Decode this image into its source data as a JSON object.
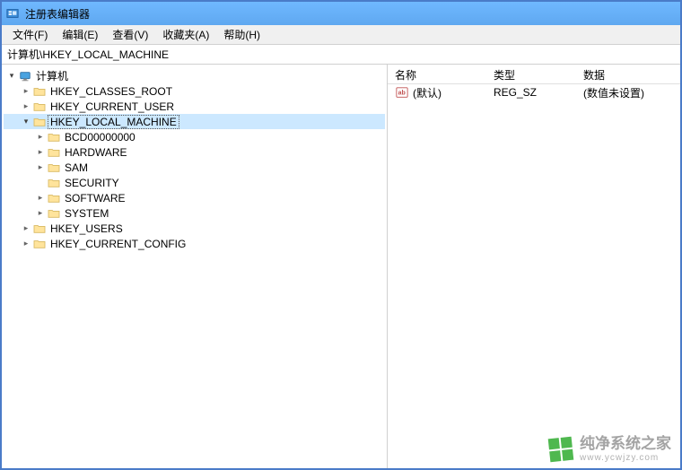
{
  "window": {
    "title": "注册表编辑器"
  },
  "menu": {
    "file": "文件(F)",
    "edit": "编辑(E)",
    "view": "查看(V)",
    "favorites": "收藏夹(A)",
    "help": "帮助(H)"
  },
  "address": {
    "path": "计算机\\HKEY_LOCAL_MACHINE"
  },
  "tree": {
    "root": "计算机",
    "hkcr": "HKEY_CLASSES_ROOT",
    "hkcu": "HKEY_CURRENT_USER",
    "hklm": "HKEY_LOCAL_MACHINE",
    "hklm_children": {
      "bcd": "BCD00000000",
      "hardware": "HARDWARE",
      "sam": "SAM",
      "security": "SECURITY",
      "software": "SOFTWARE",
      "system": "SYSTEM"
    },
    "hku": "HKEY_USERS",
    "hkcc": "HKEY_CURRENT_CONFIG"
  },
  "list": {
    "columns": {
      "name": "名称",
      "type": "类型",
      "data": "数据"
    },
    "rows": [
      {
        "name": "(默认)",
        "type": "REG_SZ",
        "data": "(数值未设置)"
      }
    ]
  },
  "watermark": {
    "brand": "纯净系统之家",
    "url": "www.ycwjzy.com"
  }
}
